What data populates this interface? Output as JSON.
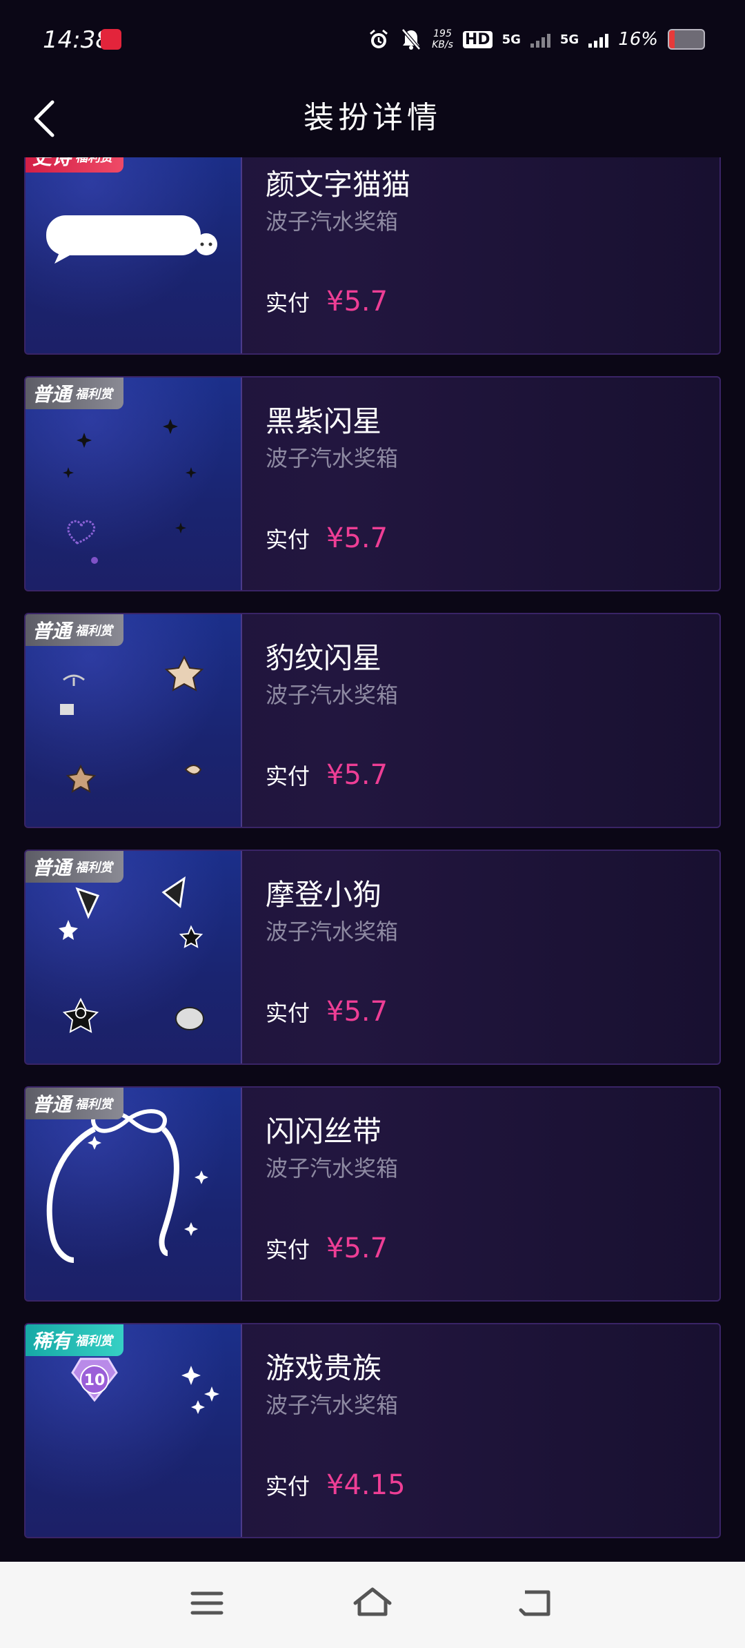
{
  "status_bar": {
    "time": "14:38",
    "net_speed_value": "195",
    "net_speed_unit": "KB/s",
    "hd_label": "HD",
    "net1": "5G",
    "net2": "5G",
    "battery_percent": "16%",
    "battery_level": 0.16,
    "icons": [
      "alarm-icon",
      "mute-bell-icon",
      "signal-icon",
      "battery-icon"
    ]
  },
  "header": {
    "title": "装扮详情",
    "back_icon": "chevron-left-icon"
  },
  "items": [
    {
      "name": "颜文字猫猫",
      "source": "波子汽水奖箱",
      "pay_label": "实付",
      "price": "¥5.7",
      "badge_tier": "史诗",
      "badge_sub": "福利赏",
      "badge_type": "hist"
    },
    {
      "name": "黑紫闪星",
      "source": "波子汽水奖箱",
      "pay_label": "实付",
      "price": "¥5.7",
      "badge_tier": "普通",
      "badge_sub": "福利赏",
      "badge_type": "normal"
    },
    {
      "name": "豹纹闪星",
      "source": "波子汽水奖箱",
      "pay_label": "实付",
      "price": "¥5.7",
      "badge_tier": "普通",
      "badge_sub": "福利赏",
      "badge_type": "normal"
    },
    {
      "name": "摩登小狗",
      "source": "波子汽水奖箱",
      "pay_label": "实付",
      "price": "¥5.7",
      "badge_tier": "普通",
      "badge_sub": "福利赏",
      "badge_type": "normal"
    },
    {
      "name": "闪闪丝带",
      "source": "波子汽水奖箱",
      "pay_label": "实付",
      "price": "¥5.7",
      "badge_tier": "普通",
      "badge_sub": "福利赏",
      "badge_type": "normal"
    },
    {
      "name": "游戏贵族",
      "source": "波子汽水奖箱",
      "pay_label": "实付",
      "price": "¥4.15",
      "badge_tier": "稀有",
      "badge_sub": "福利赏",
      "badge_type": "rare",
      "level_badge": "10"
    }
  ],
  "nav_bar": {
    "buttons": [
      "menu-icon",
      "home-icon",
      "back-icon"
    ]
  },
  "colors": {
    "background": "#0b0716",
    "price": "#ee3e95",
    "source_text": "#8e8aa2",
    "card_border": "#3a2466"
  }
}
